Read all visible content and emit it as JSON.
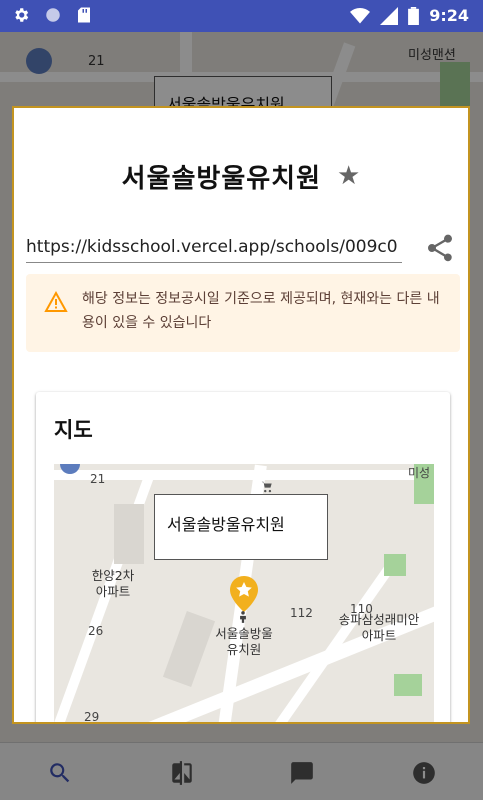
{
  "status_bar": {
    "time": "9:24"
  },
  "background_map": {
    "labels": [
      "21",
      "미성맨션"
    ],
    "popup_label": "서울솔방울유치원"
  },
  "dialog": {
    "title": "서울솔방울유치원",
    "url": "https://kidsschool.vercel.app/schools/009c0",
    "warning": "해당 정보는 정보공시일 기준으로 제공되며, 현재와는 다른 내용이 있을 수 있습니다",
    "map_card": {
      "title": "지도",
      "popup": "서울솔방울유치원",
      "labels": {
        "n21": "21",
        "area1": "한양2차\n아파트",
        "n26": "26",
        "n112": "112",
        "n110": "110",
        "apt2": "송파삼성래미안\n아파트",
        "school": "서울솔방울\n유치원",
        "corner": "미성",
        "n29": "29"
      }
    }
  },
  "colors": {
    "status_bar": "#3f51b5",
    "accent_border": "#c39420",
    "warning_bg": "#fff4e5",
    "marker": "#f2b01e"
  },
  "icons": [
    "gear-icon",
    "circle-icon",
    "sd-card-icon",
    "wifi-icon",
    "signal-icon",
    "battery-icon",
    "star-icon",
    "share-icon",
    "warning-icon",
    "search-icon",
    "compare-icon",
    "chat-icon",
    "info-icon"
  ]
}
